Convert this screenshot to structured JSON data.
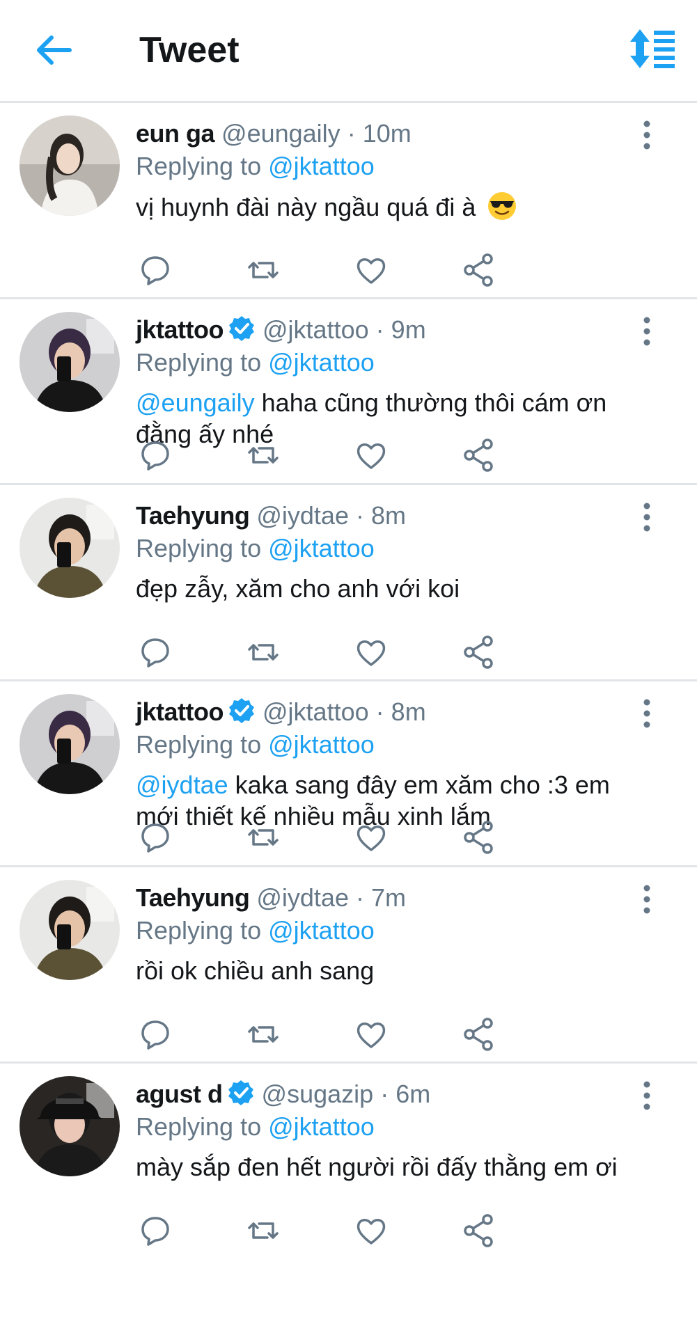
{
  "header": {
    "title": "Tweet",
    "back_icon": "arrow-left-icon",
    "sort_icon": "sort-icon"
  },
  "colors": {
    "accent": "#1da1f2",
    "text": "#14171a",
    "muted": "#657786",
    "divider": "#e1e5e8"
  },
  "tweets": [
    {
      "name": "eun ga",
      "verified": false,
      "handle": "@eungaily",
      "dot": "·",
      "time": "10m",
      "replying_prefix": "Replying to",
      "replying_to": "@jktattoo",
      "mention": "",
      "text": "vị huynh đài này ngầu quá đi à",
      "emoji": "smiling-face-with-sunglasses"
    },
    {
      "name": "jktattoo",
      "verified": true,
      "handle": "@jktattoo",
      "dot": "·",
      "time": "9m",
      "replying_prefix": "Replying to",
      "replying_to": "@jktattoo",
      "mention": "@eungaily",
      "text": " haha cũng thường thôi cám ơn đằng ấy nhé"
    },
    {
      "name": "Taehyung",
      "verified": false,
      "handle": "@iydtae",
      "dot": "·",
      "time": "8m",
      "replying_prefix": "Replying to",
      "replying_to": "@jktattoo",
      "mention": "",
      "text": "đẹp zẫy, xăm cho anh với koi"
    },
    {
      "name": "jktattoo",
      "verified": true,
      "handle": "@jktattoo",
      "dot": "·",
      "time": "8m",
      "replying_prefix": "Replying to",
      "replying_to": "@jktattoo",
      "mention": "@iydtae",
      "text": " kaka sang đây em xăm cho :3 em mới thiết kế nhiều mẫu xinh lắm"
    },
    {
      "name": "Taehyung",
      "verified": false,
      "handle": "@iydtae",
      "dot": "·",
      "time": "7m",
      "replying_prefix": "Replying to",
      "replying_to": "@jktattoo",
      "mention": "",
      "text": "rồi ok chiều anh sang"
    },
    {
      "name": "agust d",
      "verified": true,
      "handle": "@sugazip",
      "dot": "·",
      "time": "6m",
      "replying_prefix": "Replying to",
      "replying_to": "@jktattoo",
      "mention": "",
      "text": "mày sắp đen hết người rồi đấy thằng em ơi"
    }
  ],
  "action_icons": [
    "reply-icon",
    "retweet-icon",
    "like-icon",
    "share-icon"
  ]
}
